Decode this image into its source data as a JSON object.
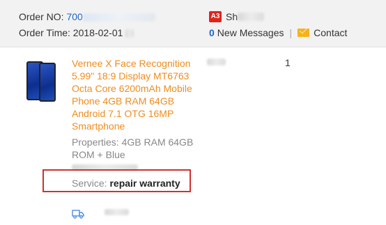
{
  "order": {
    "no_label": "Order NO:",
    "no_value": "700",
    "time_label": "Order Time:",
    "time_value": "2018-02-01"
  },
  "seller": {
    "badge": "A3",
    "name_partial": "Sh"
  },
  "messages": {
    "count": "0",
    "label": "New Messages",
    "separator": "|",
    "contact": "Contact"
  },
  "product": {
    "title": "Vernee X Face Recognition 5.99\" 18:9 Display MT6763 Octa Core 6200mAh Mobile Phone 4GB RAM 64GB Android 7.1 OTG 16MP Smartphone",
    "properties": "Properties: 4GB RAM 64GB ROM + Blue",
    "service_label": "Service:",
    "service_value": "repair warranty",
    "quantity": "1"
  },
  "icons": {
    "mail": "mail-icon",
    "truck": "shipping-truck-icon"
  },
  "colors": {
    "product_title": "#f08c1e",
    "link": "#1e64c8",
    "highlight_box": "#d32f2f",
    "badge": "#e2231a"
  }
}
